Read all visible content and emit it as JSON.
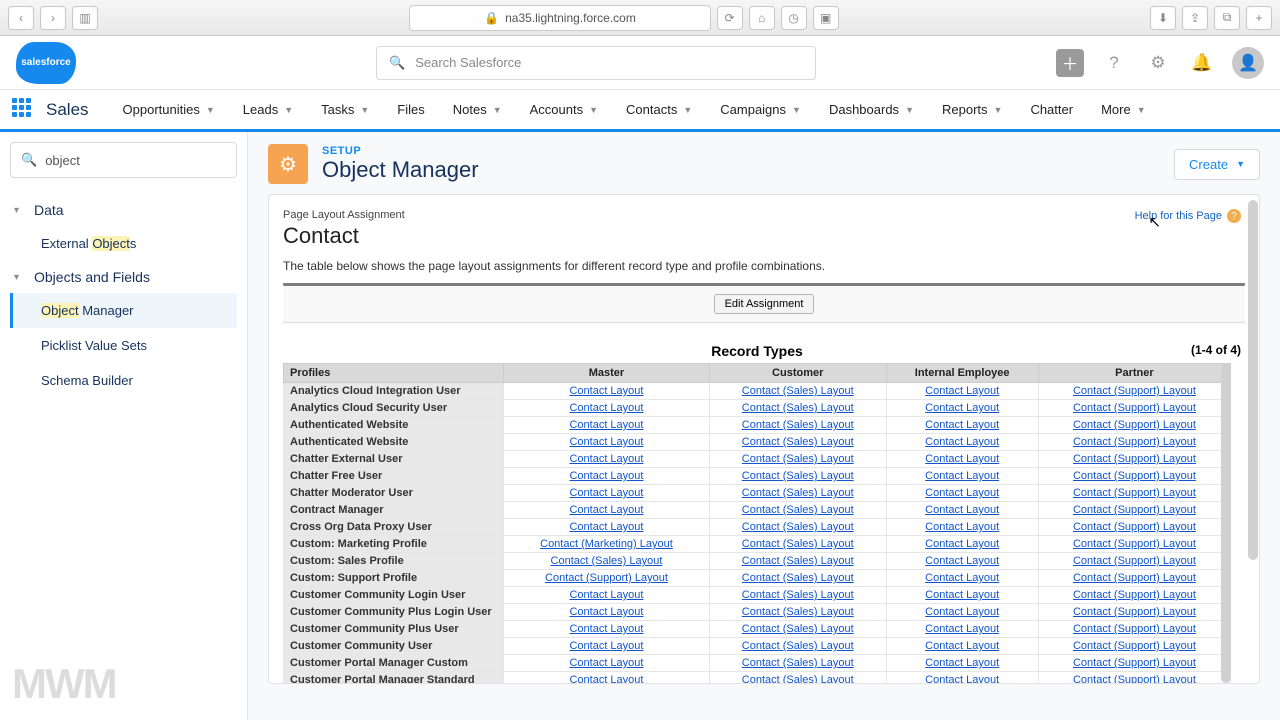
{
  "browser": {
    "url": "na35.lightning.force.com",
    "lock": "🔒"
  },
  "header": {
    "search_placeholder": "Search Salesforce",
    "logo": "salesforce"
  },
  "nav": {
    "app": "Sales",
    "items": [
      "Opportunities",
      "Leads",
      "Tasks",
      "Files",
      "Notes",
      "Accounts",
      "Contacts",
      "Campaigns",
      "Dashboards",
      "Reports",
      "Chatter",
      "More"
    ],
    "chev_on": [
      true,
      true,
      true,
      false,
      true,
      true,
      true,
      true,
      true,
      true,
      false,
      true
    ]
  },
  "sidebar": {
    "search": "object",
    "groups": [
      {
        "label": "Data",
        "items": [
          {
            "label_pre": "External ",
            "label_hl": "Object",
            "label_post": "s",
            "active": false
          }
        ]
      },
      {
        "label": "Objects and Fields",
        "items": [
          {
            "label_pre": "",
            "label_hl": "Object",
            "label_post": " Manager",
            "active": true
          },
          {
            "label_pre": "Picklist Value Sets",
            "label_hl": "",
            "label_post": "",
            "active": false
          },
          {
            "label_pre": "Schema Builder",
            "label_hl": "",
            "label_post": "",
            "active": false
          }
        ]
      }
    ],
    "watermark": "MWM"
  },
  "setup": {
    "eyebrow": "SETUP",
    "title": "Object Manager",
    "create": "Create"
  },
  "panel": {
    "small": "Page Layout Assignment",
    "title": "Contact",
    "desc": "The table below shows the page layout assignments for different record type and profile combinations.",
    "help": "Help for this Page",
    "edit_btn": "Edit Assignment",
    "record_types_label": "Record Types",
    "count": "(1-4 of 4)",
    "columns": {
      "profiles": "Profiles",
      "c1": "Master",
      "c2": "Customer",
      "c3": "Internal Employee",
      "c4": "Partner"
    },
    "rows": [
      {
        "p": "Analytics Cloud Integration User",
        "c1": "Contact Layout",
        "c2": "Contact (Sales) Layout",
        "c3": "Contact Layout",
        "c4": "Contact (Support) Layout"
      },
      {
        "p": "Analytics Cloud Security User",
        "c1": "Contact Layout",
        "c2": "Contact (Sales) Layout",
        "c3": "Contact Layout",
        "c4": "Contact (Support) Layout"
      },
      {
        "p": "Authenticated Website",
        "c1": "Contact Layout",
        "c2": "Contact (Sales) Layout",
        "c3": "Contact Layout",
        "c4": "Contact (Support) Layout"
      },
      {
        "p": "Authenticated Website",
        "c1": "Contact Layout",
        "c2": "Contact (Sales) Layout",
        "c3": "Contact Layout",
        "c4": "Contact (Support) Layout"
      },
      {
        "p": "Chatter External User",
        "c1": "Contact Layout",
        "c2": "Contact (Sales) Layout",
        "c3": "Contact Layout",
        "c4": "Contact (Support) Layout"
      },
      {
        "p": "Chatter Free User",
        "c1": "Contact Layout",
        "c2": "Contact (Sales) Layout",
        "c3": "Contact Layout",
        "c4": "Contact (Support) Layout"
      },
      {
        "p": "Chatter Moderator User",
        "c1": "Contact Layout",
        "c2": "Contact (Sales) Layout",
        "c3": "Contact Layout",
        "c4": "Contact (Support) Layout"
      },
      {
        "p": "Contract Manager",
        "c1": "Contact Layout",
        "c2": "Contact (Sales) Layout",
        "c3": "Contact Layout",
        "c4": "Contact (Support) Layout"
      },
      {
        "p": "Cross Org Data Proxy User",
        "c1": "Contact Layout",
        "c2": "Contact (Sales) Layout",
        "c3": "Contact Layout",
        "c4": "Contact (Support) Layout"
      },
      {
        "p": "Custom: Marketing Profile",
        "c1": "Contact (Marketing) Layout",
        "c2": "Contact (Sales) Layout",
        "c3": "Contact Layout",
        "c4": "Contact (Support) Layout"
      },
      {
        "p": "Custom: Sales Profile",
        "c1": "Contact (Sales) Layout",
        "c2": "Contact (Sales) Layout",
        "c3": "Contact Layout",
        "c4": "Contact (Support) Layout"
      },
      {
        "p": "Custom: Support Profile",
        "c1": "Contact (Support) Layout",
        "c2": "Contact (Sales) Layout",
        "c3": "Contact Layout",
        "c4": "Contact (Support) Layout"
      },
      {
        "p": "Customer Community Login User",
        "c1": "Contact Layout",
        "c2": "Contact (Sales) Layout",
        "c3": "Contact Layout",
        "c4": "Contact (Support) Layout"
      },
      {
        "p": "Customer Community Plus Login User",
        "c1": "Contact Layout",
        "c2": "Contact (Sales) Layout",
        "c3": "Contact Layout",
        "c4": "Contact (Support) Layout"
      },
      {
        "p": "Customer Community Plus User",
        "c1": "Contact Layout",
        "c2": "Contact (Sales) Layout",
        "c3": "Contact Layout",
        "c4": "Contact (Support) Layout"
      },
      {
        "p": "Customer Community User",
        "c1": "Contact Layout",
        "c2": "Contact (Sales) Layout",
        "c3": "Contact Layout",
        "c4": "Contact (Support) Layout"
      },
      {
        "p": "Customer Portal Manager Custom",
        "c1": "Contact Layout",
        "c2": "Contact (Sales) Layout",
        "c3": "Contact Layout",
        "c4": "Contact (Support) Layout"
      },
      {
        "p": "Customer Portal Manager Standard",
        "c1": "Contact Layout",
        "c2": "Contact (Sales) Layout",
        "c3": "Contact Layout",
        "c4": "Contact (Support) Layout"
      }
    ]
  }
}
